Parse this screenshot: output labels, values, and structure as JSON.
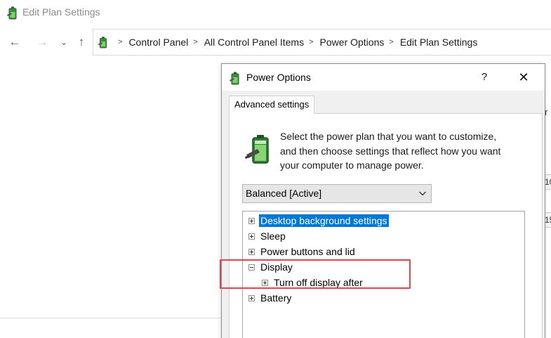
{
  "window": {
    "title": "Edit Plan Settings",
    "app_icon": "power-options-icon"
  },
  "nav": {
    "back_icon": "back-arrow-icon",
    "forward_icon": "forward-arrow-icon",
    "recent_icon": "chevron-down-icon",
    "up_icon": "up-arrow-icon",
    "breadcrumbs": [
      "Control Panel",
      "All Control Panel Items",
      "Power Options",
      "Edit Plan Settings"
    ]
  },
  "background_fragments": {
    "right_label": "r",
    "right_field_1": "10",
    "right_field_2": "15"
  },
  "dialog": {
    "title": "Power Options",
    "help_label": "?",
    "close_label": "✕",
    "tab_label": "Advanced settings",
    "description_lines": [
      "Select the power plan that you want to customize,",
      "and then choose settings that reflect how you want",
      "your computer to manage power."
    ],
    "plan_select": {
      "value": "Balanced [Active]"
    },
    "tree": {
      "items": [
        {
          "label": "Desktop background settings",
          "expanded": false,
          "selected": true,
          "level": 0
        },
        {
          "label": "Sleep",
          "expanded": false,
          "selected": false,
          "level": 0
        },
        {
          "label": "Power buttons and lid",
          "expanded": false,
          "selected": false,
          "level": 0
        },
        {
          "label": "Display",
          "expanded": true,
          "selected": false,
          "level": 0
        },
        {
          "label": "Turn off display after",
          "expanded": false,
          "selected": false,
          "level": 1
        },
        {
          "label": "Battery",
          "expanded": false,
          "selected": false,
          "level": 0
        }
      ]
    }
  },
  "colors": {
    "selection": "#0078d7",
    "highlight_annotation": "#e3434a",
    "dialog_background": "#f0f0f0"
  }
}
